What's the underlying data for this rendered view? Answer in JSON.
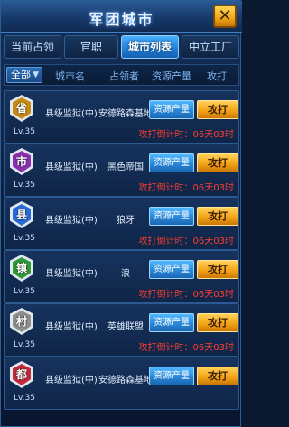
{
  "window": {
    "title": "军团城市",
    "close_label": "✕"
  },
  "tabs": [
    {
      "label": "当前占领",
      "active": false
    },
    {
      "label": "官职",
      "active": false
    },
    {
      "label": "城市列表",
      "active": true
    },
    {
      "label": "中立工厂",
      "active": false
    }
  ],
  "table": {
    "filter_label": "全部",
    "headers": [
      "城市名",
      "占领者",
      "资源产量",
      "攻打"
    ]
  },
  "rows": [
    {
      "badge_char": "省",
      "badge_color": "#c98a10",
      "level": "Lv.35",
      "city_level": "县级监狱(中)",
      "occupant": "安德路森基地",
      "res_label": "资源产量",
      "attack_label": "攻打",
      "countdown": "攻打倒计时：06天03时"
    },
    {
      "badge_char": "市",
      "badge_color": "#8a2fb0",
      "level": "Lv.35",
      "city_level": "县级监狱(中)",
      "occupant": "黑色帝国",
      "res_label": "资源产量",
      "attack_label": "攻打",
      "countdown": "攻打倒计时：06天03时"
    },
    {
      "badge_char": "县",
      "badge_color": "#2a6ad6",
      "level": "Lv.35",
      "city_level": "县级监狱(中)",
      "occupant": "狼牙",
      "res_label": "资源产量",
      "attack_label": "攻打",
      "countdown": "攻打倒计时：06天03时"
    },
    {
      "badge_char": "镇",
      "badge_color": "#2f9a36",
      "level": "Lv.35",
      "city_level": "县级监狱(中)",
      "occupant": "浪",
      "res_label": "资源产量",
      "attack_label": "攻打",
      "countdown": "攻打倒计时：06天03时"
    },
    {
      "badge_char": "村",
      "badge_color": "#8f8f8f",
      "level": "Lv.35",
      "city_level": "县级监狱(中)",
      "occupant": "英雄联盟",
      "res_label": "资源产量",
      "attack_label": "攻打",
      "countdown": "攻打倒计时：06天03时"
    },
    {
      "badge_char": "都",
      "badge_color": "#c42a3a",
      "level": "Lv.35",
      "city_level": "县级监狱(中)",
      "occupant": "安德路森基地",
      "res_label": "资源产量",
      "attack_label": "攻打",
      "countdown": ""
    }
  ]
}
